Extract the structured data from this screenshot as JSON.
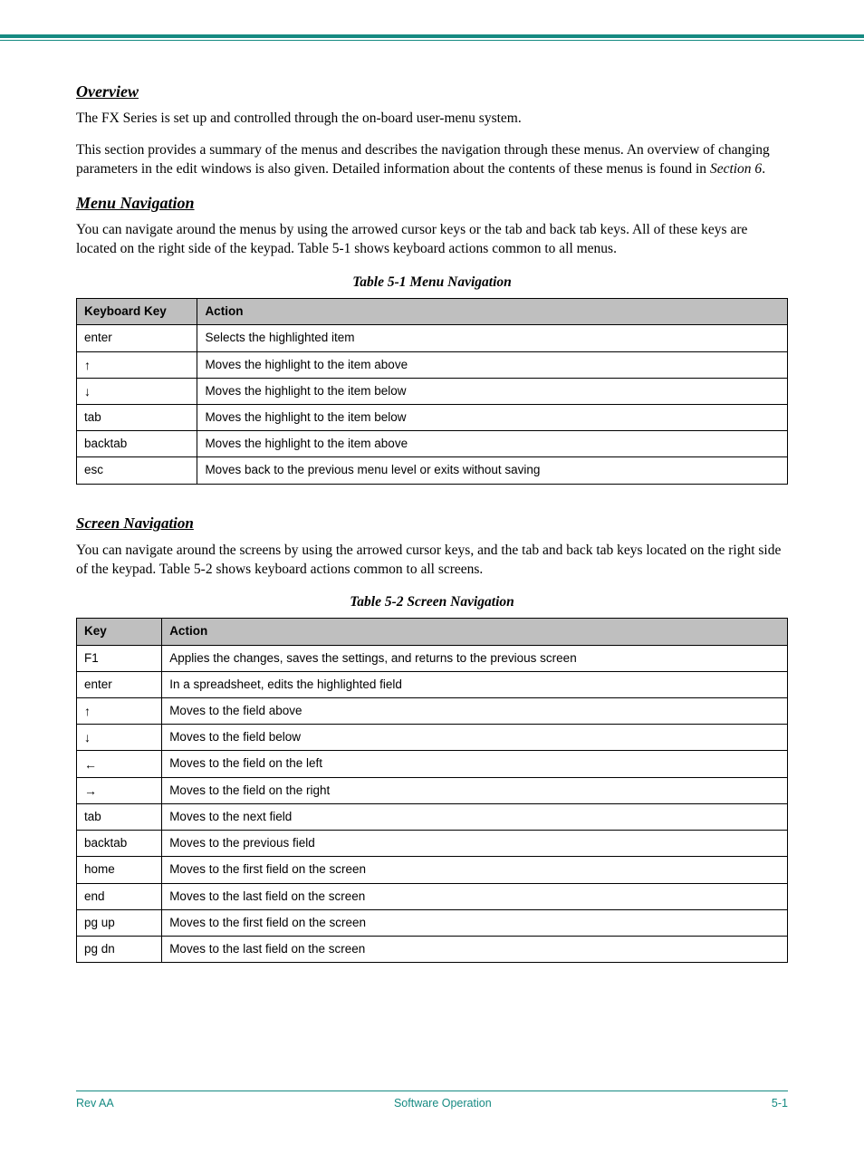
{
  "headings": {
    "overview": "Overview",
    "menuNav": "Menu Navigation",
    "screenNav": "Screen Navigation"
  },
  "intro": {
    "p1": "The FX Series is set up and controlled through the on-board user-menu system.",
    "p2_a": "This section provides a summary of the menus and describes the navigation through these menus. An overview of changing parameters in the edit windows is also given. Detailed information about the contents of these menus is found in ",
    "p2_link": "Section 6",
    "p2_b": "."
  },
  "menuNav": {
    "p1": "You can navigate around the menus by using the arrowed cursor keys or the tab and back tab keys. All of these keys are located on the right side of the keypad. Table 5-1 shows keyboard actions common to all menus."
  },
  "table1": {
    "caption": "Table 5-1  Menu Navigation",
    "headers": {
      "key": "Keyboard Key",
      "action": "Action"
    },
    "rows": [
      {
        "key": "enter",
        "action": "Selects the highlighted item"
      },
      {
        "key": "↑",
        "action": "Moves the highlight to the item above"
      },
      {
        "key": "↓",
        "action": "Moves the highlight to the item below"
      },
      {
        "key": "tab",
        "action": "Moves the highlight to the item below"
      },
      {
        "key": "backtab",
        "action": "Moves the highlight to the item above"
      },
      {
        "key": "esc",
        "action": "Moves back to the previous menu level or exits without saving"
      }
    ]
  },
  "screenNav": {
    "p1": "You can navigate around the screens by using the arrowed cursor keys, and the tab and back tab keys located on the right side of the keypad. Table 5-2 shows keyboard actions common to all screens."
  },
  "table2": {
    "caption": "Table 5-2  Screen Navigation",
    "headers": {
      "key": "Key",
      "action": "Action"
    },
    "rows": [
      {
        "key": "F1",
        "action": "Applies the changes, saves the settings, and returns to the previous screen"
      },
      {
        "key": "enter",
        "action": "In a spreadsheet, edits the highlighted field"
      },
      {
        "key": "↑",
        "action": "Moves to the field above"
      },
      {
        "key": "↓",
        "action": "Moves to the field below"
      },
      {
        "key": "←",
        "action": "Moves to the field on the left"
      },
      {
        "key": "→",
        "action": "Moves to the field on the right"
      },
      {
        "key": "tab",
        "action": "Moves to the next field"
      },
      {
        "key": "backtab",
        "action": "Moves to the previous field"
      },
      {
        "key": "home",
        "action": "Moves to the first field on the screen"
      },
      {
        "key": "end",
        "action": "Moves to the last field on the screen"
      },
      {
        "key": "pg up",
        "action": "Moves to the first field on the screen"
      },
      {
        "key": "pg dn",
        "action": "Moves to the last field on the screen"
      }
    ]
  },
  "footer": {
    "left": "Rev AA",
    "center": "Software Operation",
    "right": "5-1"
  }
}
